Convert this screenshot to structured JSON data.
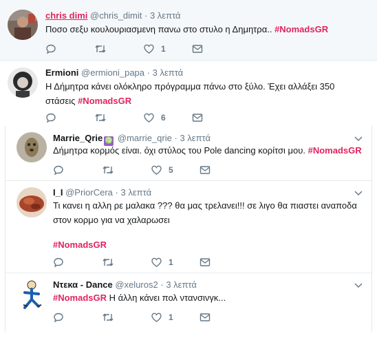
{
  "tweets": [
    {
      "name": "chris dimi",
      "handle": "@chris_dimit",
      "time": "3 λεπτά",
      "text": "Ποσο σεξυ κουλουριασμενη πανω στο στυλο η Δημητρα.. ",
      "hashtag": "#NomadsGR",
      "likes": "1"
    },
    {
      "name": "Ermioni",
      "handle": "@ermioni_papa",
      "time": "3 λεπτά",
      "text_line1": "Η Δήμητρα κάνει ολόκληρο πρόγραμμα πάνω στο ξύλο. Έχει αλλάξει 350",
      "text_line2": "στάσεις ",
      "hashtag": "#NomadsGR",
      "likes": "6"
    },
    {
      "name": "Marrie_Qrie",
      "badge_icon": "virgo-icon",
      "handle": "@marrie_qrie",
      "time": "3 λεπτά",
      "text": "Δήμητρα κορμός είναι. όχι στύλος του Pole dancing κορίτσι μου.  ",
      "hashtag": "#NomadsGR",
      "likes": "5"
    },
    {
      "name": "I_I",
      "handle": "@PriorCera",
      "time": "3 λεπτά",
      "text_line1": "Τι κανει η αλλη ρε μαλακα ??? θα μας τρελανει!!! σε λιγο θα πιαστει αναποδα",
      "text_line2": "στον κορμο για να χαλαρωσει",
      "hashtag": "#NomadsGR",
      "likes": "1"
    },
    {
      "name": "Ντεκα - Dance",
      "handle": "@xeluros2",
      "time": "3 λεπτά",
      "hashtag": "#NomadsGR",
      "text": " Η άλλη κάνει πολ ντανσινγκ...",
      "likes": "1"
    }
  ],
  "separator": "·",
  "colors": {
    "hashtag": "#e0245e",
    "muted": "#657786",
    "highlight_bg": "#f5f8fa"
  }
}
